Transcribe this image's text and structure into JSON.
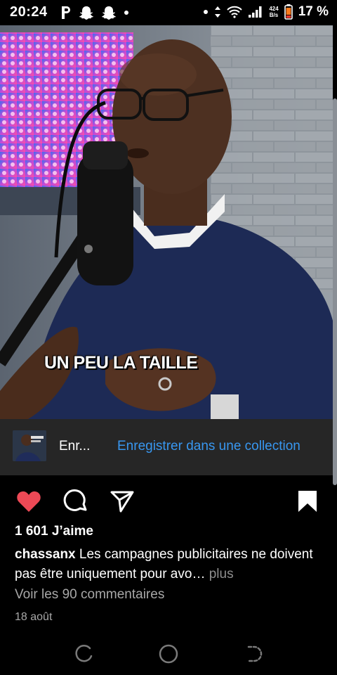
{
  "status_bar": {
    "time": "20:24",
    "left_icons": [
      "parking-icon",
      "snapchat-icon",
      "snapchat-icon",
      "dot-icon"
    ],
    "net_speed_value": "424",
    "net_speed_unit": "B/s",
    "battery": "17 %"
  },
  "post": {
    "video_caption": "UN PEU LA TAILLE",
    "save_bar": {
      "name_truncated": "Enr...",
      "action": "Enregistrer dans une collection"
    },
    "actions": {
      "liked": true,
      "saved": true,
      "like_color": "#ed4956",
      "icons": [
        "heart-icon",
        "comment-icon",
        "share-icon",
        "bookmark-icon"
      ]
    },
    "likes": "1 601 J’aime",
    "caption": {
      "user": "chassanx",
      "text": "Les campagnes publicitaires ne doivent pas être uniquement pour avo…",
      "more": "plus"
    },
    "comments_link": "Voir les 90 commentaires",
    "date": "18 août"
  },
  "nav": {
    "icons": [
      "recents-icon",
      "home-icon",
      "back-icon"
    ]
  },
  "colors": {
    "accent": "#3897f0",
    "background": "#000000",
    "save_bar_bg": "#262626"
  }
}
